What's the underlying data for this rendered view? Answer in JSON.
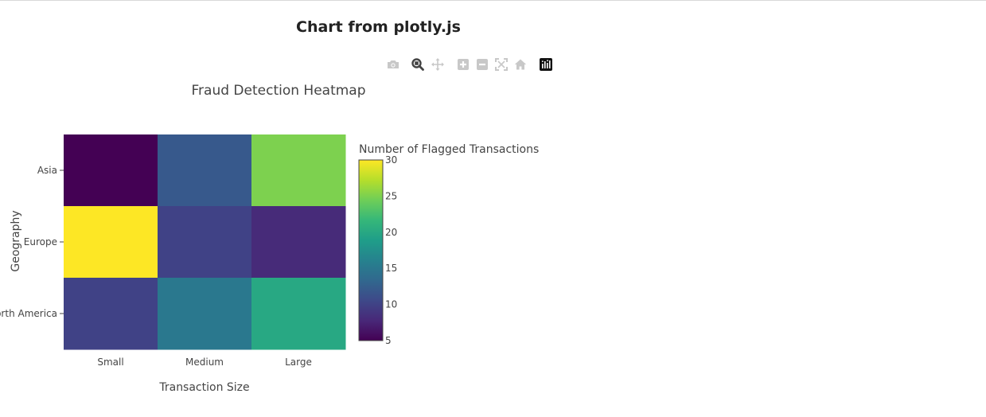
{
  "page": {
    "title": "Chart from plotly.js"
  },
  "modebar": {
    "buttons": [
      {
        "name": "camera-icon",
        "active": false
      },
      {
        "name": "zoom-icon",
        "active": true
      },
      {
        "name": "pan-icon",
        "active": false
      },
      {
        "name": "zoom-in-icon",
        "active": false
      },
      {
        "name": "zoom-out-icon",
        "active": false
      },
      {
        "name": "autoscale-icon",
        "active": false
      },
      {
        "name": "home-icon",
        "active": false
      },
      {
        "name": "plotly-logo-icon",
        "active": false
      }
    ]
  },
  "chart_data": {
    "type": "heatmap",
    "title": "Fraud Detection Heatmap",
    "xlabel": "Transaction Size",
    "ylabel": "Geography",
    "x": [
      "Small",
      "Medium",
      "Large"
    ],
    "y": [
      "Asia",
      "Europe",
      "North America"
    ],
    "z": [
      [
        5,
        12,
        25
      ],
      [
        30,
        10,
        8
      ],
      [
        10,
        15,
        20
      ]
    ],
    "colorscale": "Viridis",
    "colorbar": {
      "title": "Number of Flagged Transactions",
      "range": [
        5,
        30
      ],
      "ticks": [
        5,
        10,
        15,
        20,
        25,
        30
      ]
    },
    "grid": false
  }
}
